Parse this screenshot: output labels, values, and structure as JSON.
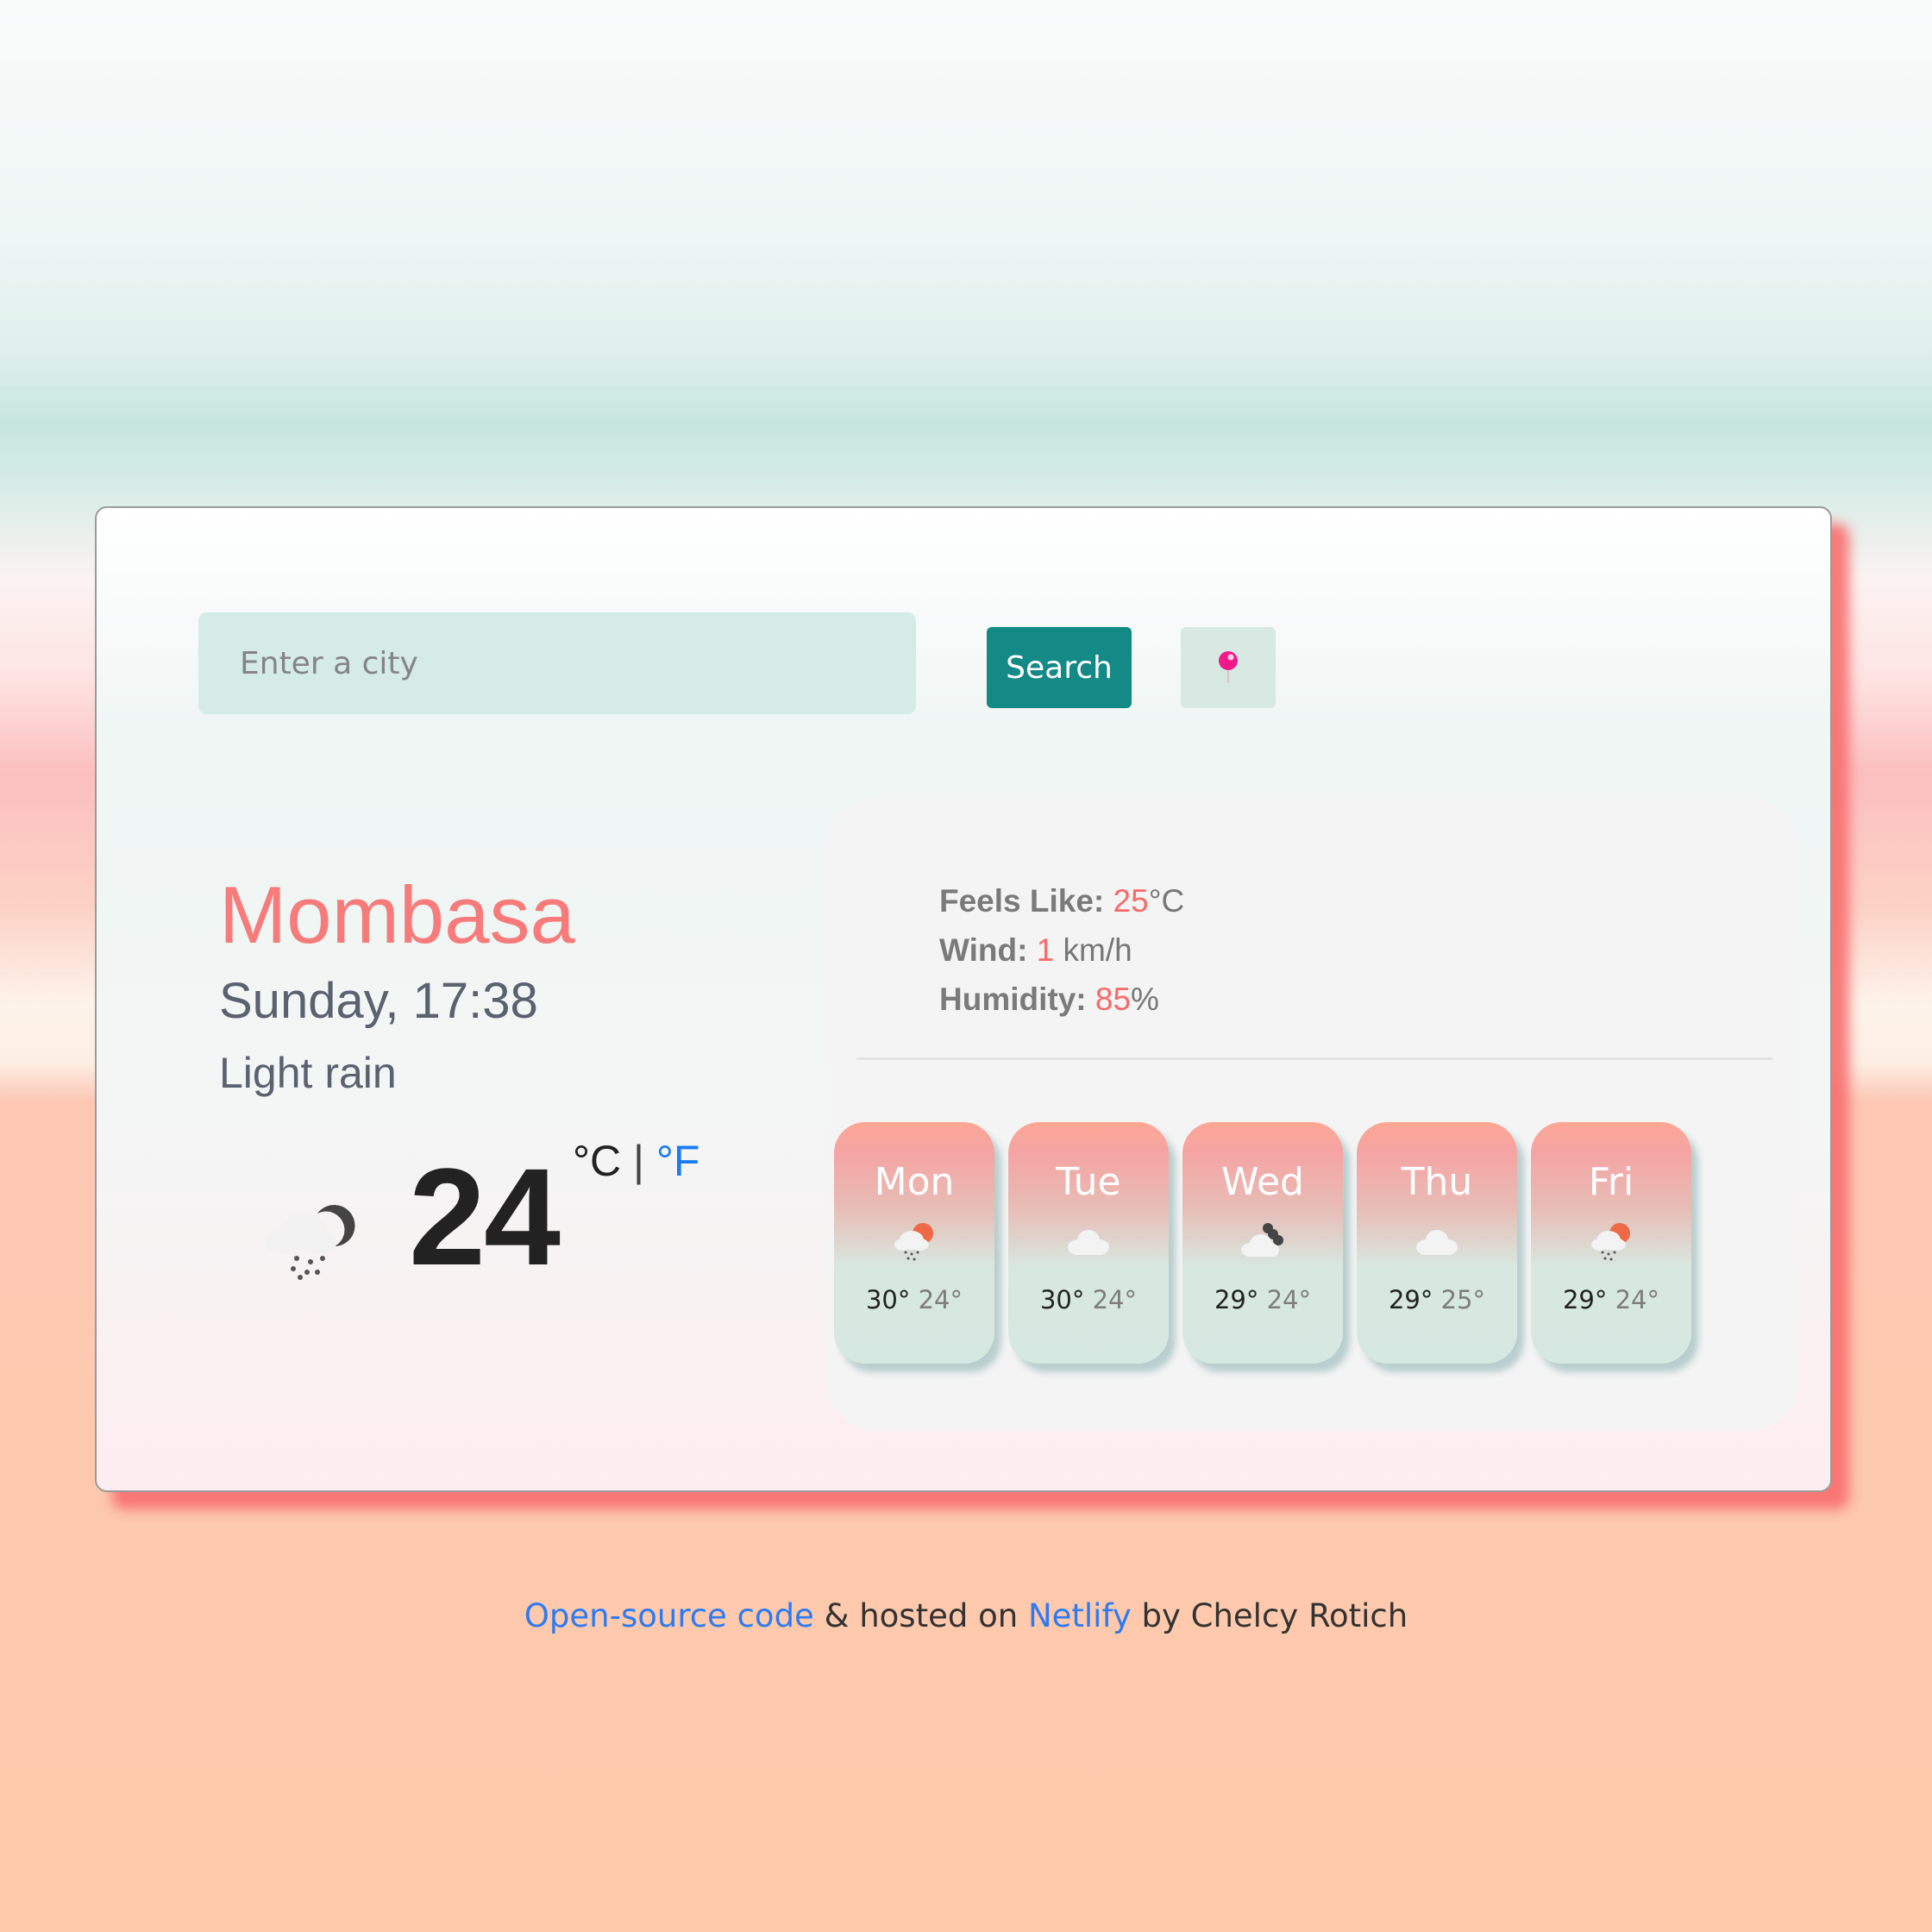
{
  "search": {
    "placeholder": "Enter a city",
    "value": "",
    "button_label": "Search",
    "location_button_icon": "pushpin-icon"
  },
  "current": {
    "city": "Mombasa",
    "datetime": "Sunday, 17:38",
    "description": "Light rain",
    "icon": "night-rain-icon",
    "temperature": "24",
    "unit_celsius": "°C",
    "unit_separator": "|",
    "unit_fahrenheit": "°F"
  },
  "details": {
    "feels_like_label": "Feels Like:",
    "feels_like_value": "25",
    "feels_like_unit": "°C",
    "wind_label": "Wind:",
    "wind_value": "1",
    "wind_unit": " km/h",
    "humidity_label": "Humidity:",
    "humidity_value": "85",
    "humidity_unit": "%"
  },
  "forecast": [
    {
      "day": "Mon",
      "icon": "sun-rain-icon",
      "max": "30°",
      "min": "24°"
    },
    {
      "day": "Tue",
      "icon": "cloud-icon",
      "max": "30°",
      "min": "24°"
    },
    {
      "day": "Wed",
      "icon": "night-cloud-icon",
      "max": "29°",
      "min": "24°"
    },
    {
      "day": "Thu",
      "icon": "cloud-icon",
      "max": "29°",
      "min": "25°"
    },
    {
      "day": "Fri",
      "icon": "sun-rain-icon",
      "max": "29°",
      "min": "24°"
    }
  ],
  "footer": {
    "code_link": "Open-source code",
    "text1": " & hosted on ",
    "netlify_link": "Netlify",
    "text2": " by Chelcy Rotich"
  },
  "colors": {
    "accent_coral": "#f77b7b",
    "button_teal": "#138a86",
    "link_blue": "#2d7bf2"
  }
}
